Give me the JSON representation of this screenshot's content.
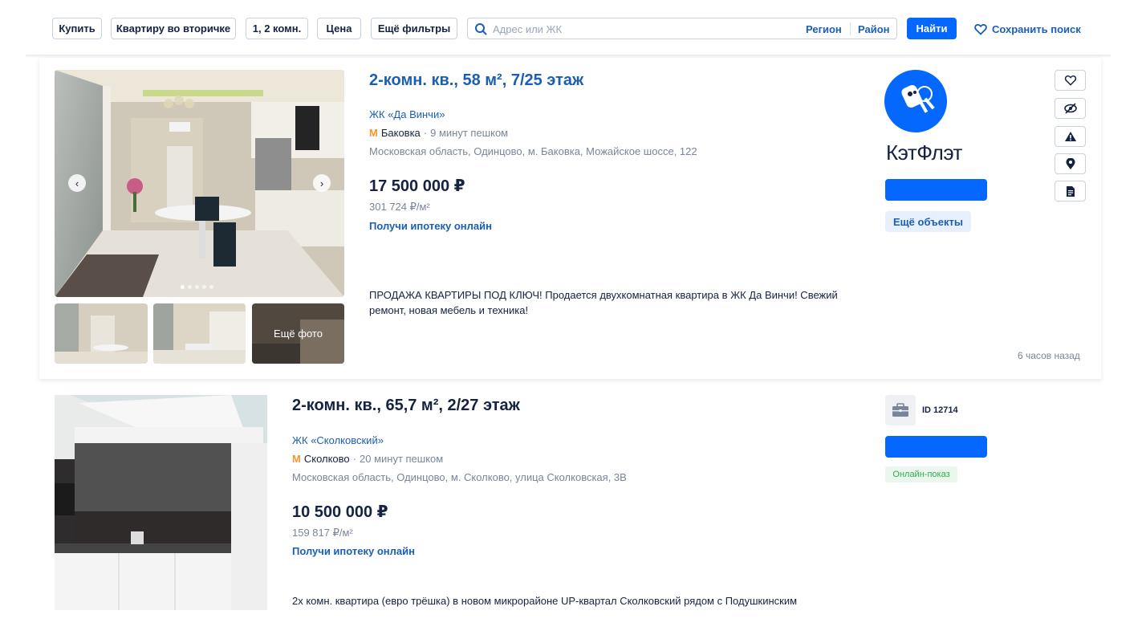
{
  "filters": {
    "buy": "Купить",
    "type": "Квартиру во вторичке",
    "rooms": "1, 2 комн.",
    "price": "Цена",
    "more": "Ещё фильтры"
  },
  "search": {
    "placeholder": "Адрес или ЖК",
    "region": "Регион",
    "district": "Район",
    "find": "Найти",
    "save": "Сохранить поиск"
  },
  "listings": [
    {
      "title": "2-комн. кв., 58 м², 7/25 этаж",
      "complex": "ЖК «Да Винчи»",
      "metro": "Баковка",
      "walk": "9 минут пешком",
      "address": "Московская область, Одинцово, м. Баковка, Можайское шоссе, 122",
      "price": "17 500 000 ₽",
      "price_per_m2": "301 724 ₽/м²",
      "mortgage": "Получи ипотеку онлайн",
      "description": "ПРОДАЖА КВАРТИРЫ ПОД КЛЮЧ! Продается двухкомнатная квартира в ЖК Да Винчи! Свежий ремонт, новая мебель и техника!",
      "more_photos": "Ещё фото",
      "posted": "6 часов назад",
      "agency": "КэтФлэт",
      "more_objects": "Ещё объекты"
    },
    {
      "title": "2-комн. кв., 65,7 м², 2/27 этаж",
      "complex": "ЖК «Сколковский»",
      "metro": "Сколково",
      "walk": "20 минут пешком",
      "address": "Московская область, Одинцово, м. Сколково, улица Сколковская, 3В",
      "price": "10 500 000 ₽",
      "price_per_m2": "159 817 ₽/м²",
      "mortgage": "Получи ипотеку онлайн",
      "description": "2х комн. квартира (евро трёшка) в новом микрорайоне UP-квартал Сколковский рядом с Подушкинским",
      "agent_id": "ID 12714",
      "online": "Онлайн-показ"
    }
  ],
  "colors": {
    "accent": "#0468ff",
    "link": "#1a5fb4",
    "text": "#152242",
    "muted": "#7a8599",
    "metro": "#f29a2e"
  }
}
